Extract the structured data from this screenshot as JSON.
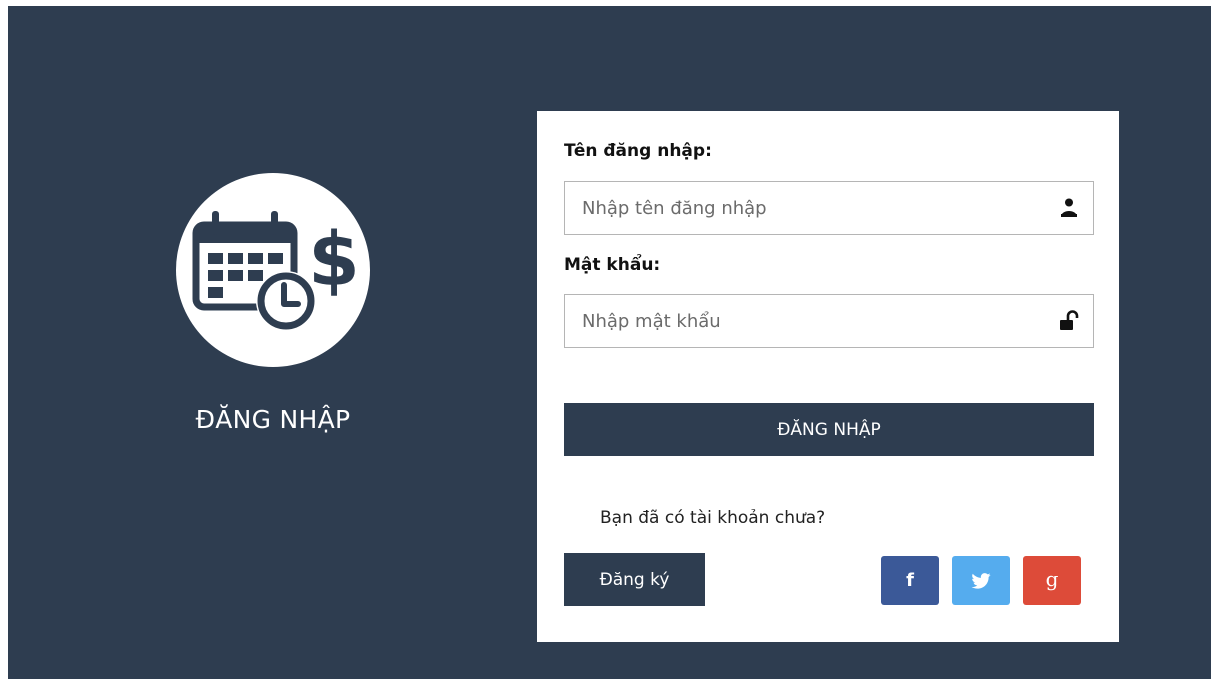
{
  "brand": {
    "logo_icon": "calendar-clock-dollar-icon",
    "title": "ĐĂNG NHẬP"
  },
  "form": {
    "username_label": "Tên đăng nhập:",
    "username_placeholder": "Nhập tên đăng nhập",
    "username_value": "",
    "username_icon": "user-icon",
    "password_label": "Mật khẩu:",
    "password_placeholder": "Nhập mật khẩu",
    "password_value": "",
    "password_icon": "unlock-icon",
    "login_button": "ĐĂNG NHẬP",
    "register_question": "Bạn đã có tài khoản chưa?",
    "register_button": "Đăng ký"
  },
  "social": [
    {
      "name": "facebook",
      "icon": "facebook-icon",
      "glyph": "f",
      "color": "#3b5998"
    },
    {
      "name": "twitter",
      "icon": "twitter-icon",
      "glyph": "",
      "color": "#55acee"
    },
    {
      "name": "google",
      "icon": "google-plus-icon",
      "glyph": "g",
      "color": "#dd4b39"
    }
  ],
  "colors": {
    "background": "#2e3d50",
    "card": "#ffffff",
    "button": "#2e3d50"
  }
}
